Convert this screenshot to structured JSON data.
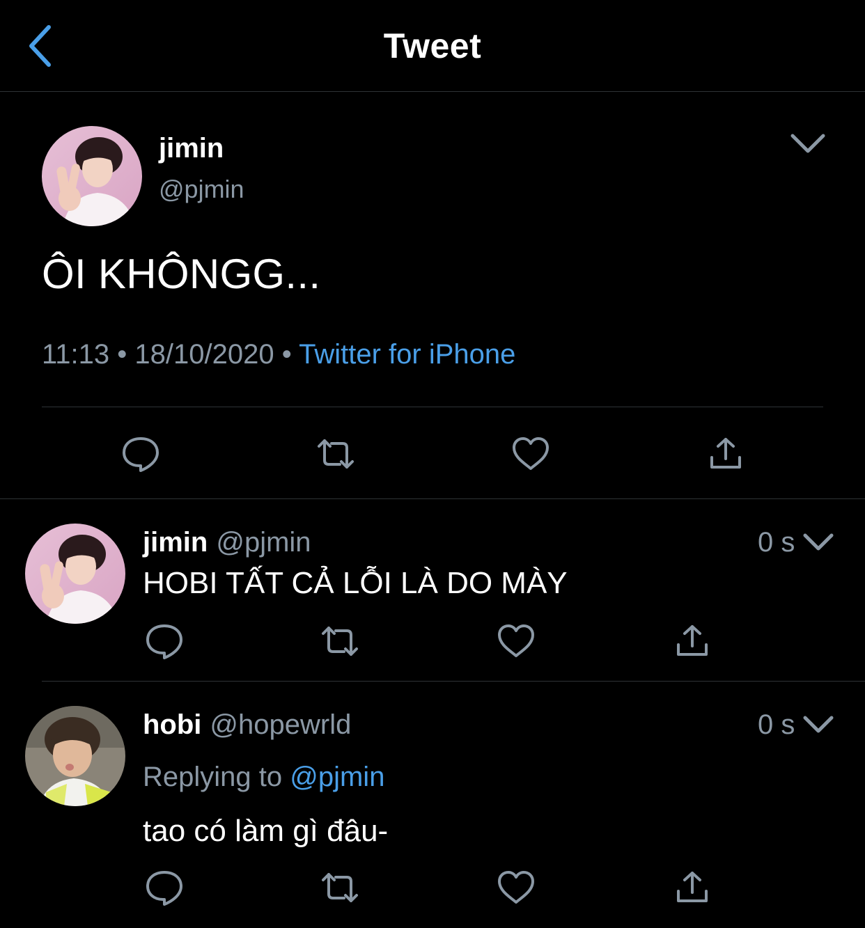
{
  "header": {
    "back_icon": "chevron-left-icon",
    "title": "Tweet"
  },
  "colors": {
    "background": "#000000",
    "accent": "#4a9fe8",
    "secondary_text": "#8b98a5",
    "divider": "#2f3336",
    "icon_gray": "#8b98a5"
  },
  "main_tweet": {
    "display_name": "jimin",
    "handle": "@pjmin",
    "text": "ÔI KHÔNGG...",
    "time": "11:13",
    "date": "18/10/2020",
    "separator": "•",
    "source": "Twitter for iPhone",
    "actions": [
      "reply-icon",
      "retweet-icon",
      "like-icon",
      "share-icon"
    ]
  },
  "replies": [
    {
      "display_name": "jimin",
      "handle": "@pjmin",
      "time": "0 s",
      "text": "HOBI TẤT CẢ LỖI LÀ DO MÀY",
      "actions": [
        "reply-icon",
        "retweet-icon",
        "like-icon",
        "share-icon"
      ]
    },
    {
      "display_name": "hobi",
      "handle": "@hopewrld",
      "time": "0 s",
      "replying_prefix": "Replying to",
      "replying_to": "@pjmin",
      "text": "tao có làm gì đâu-",
      "actions": [
        "reply-icon",
        "retweet-icon",
        "like-icon",
        "share-icon"
      ]
    }
  ]
}
